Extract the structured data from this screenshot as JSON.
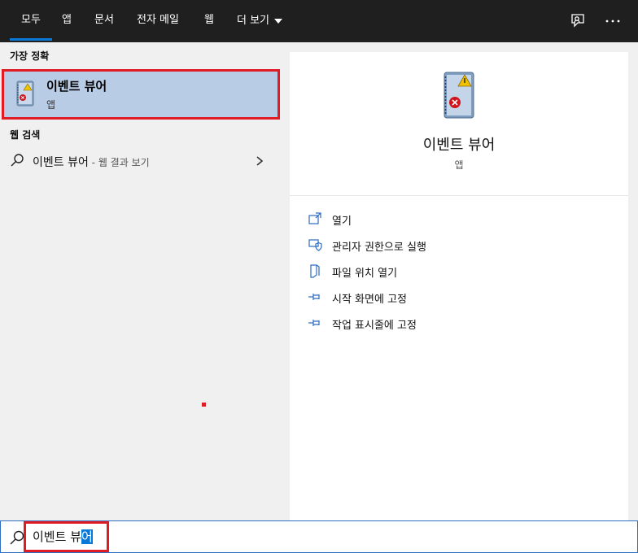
{
  "tabs": [
    {
      "label": "모두",
      "active": true
    },
    {
      "label": "앱"
    },
    {
      "label": "문서"
    },
    {
      "label": "전자 메일"
    },
    {
      "label": "웹"
    },
    {
      "label": "더 보기"
    }
  ],
  "left": {
    "best_match_heading": "가장 정확",
    "best_match": {
      "title": "이벤트 뷰어",
      "subtitle": "앱"
    },
    "web_search_heading": "웹 검색",
    "web_result": {
      "query": "이벤트 뷰어",
      "hint": " - 웹 결과 보기"
    }
  },
  "right": {
    "app_name": "이벤트 뷰어",
    "app_type": "앱",
    "actions": [
      {
        "label": "열기",
        "icon": "open-icon"
      },
      {
        "label": "관리자 권한으로 실행",
        "icon": "shield-icon"
      },
      {
        "label": "파일 위치 열기",
        "icon": "file-location-icon"
      },
      {
        "label": "시작 화면에 고정",
        "icon": "pin-icon"
      },
      {
        "label": "작업 표시줄에 고정",
        "icon": "pin-icon"
      }
    ]
  },
  "search": {
    "text_unselected": "이벤트 뷰",
    "text_selected": "어"
  },
  "colors": {
    "accent": "#0a78d7",
    "highlight_border": "#e21a23",
    "best_match_bg": "#b8cce6",
    "topbar_bg": "#1f1f1f"
  }
}
